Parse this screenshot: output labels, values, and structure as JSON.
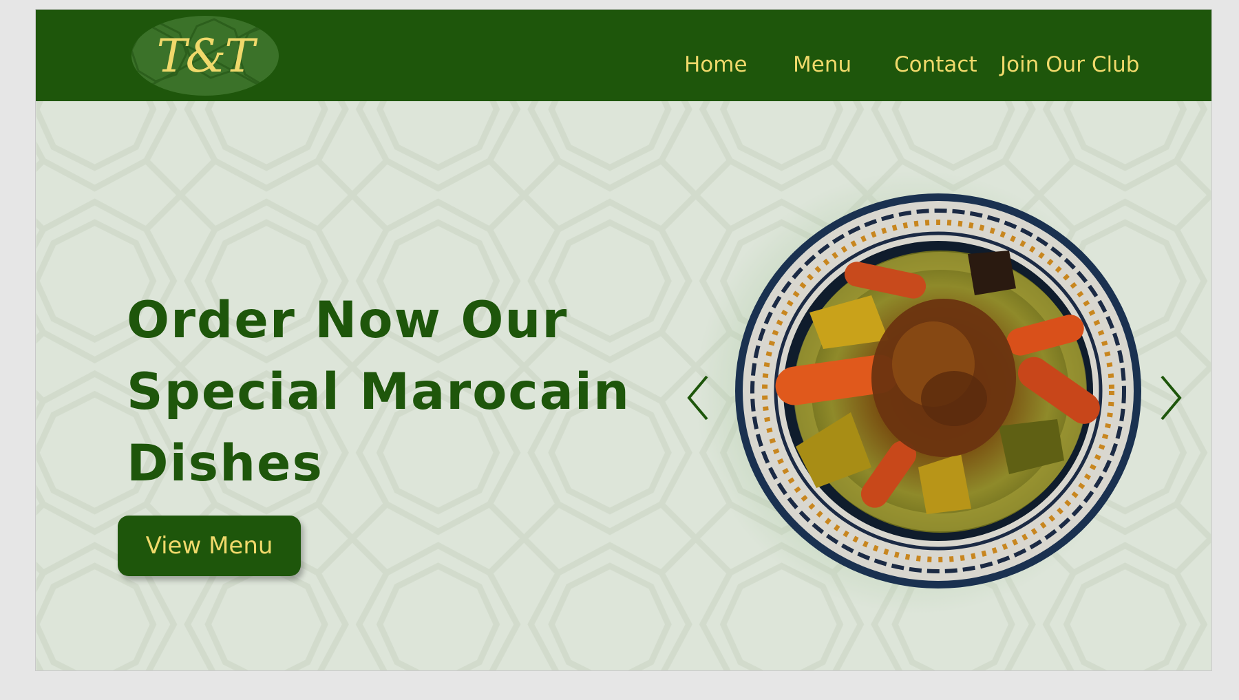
{
  "logo": {
    "text": "T&T"
  },
  "nav": {
    "items": [
      {
        "label": "Home"
      },
      {
        "label": "Menu"
      },
      {
        "label": "Contact"
      },
      {
        "label": "Join Our Club"
      }
    ]
  },
  "hero": {
    "title_lines": [
      "Order Now Our",
      "Special Marocain",
      "Dishes"
    ],
    "button_label": "View Menu"
  },
  "carousel": {
    "prev_icon": "chevron-left-icon",
    "next_icon": "chevron-right-icon"
  },
  "colors": {
    "brand_green": "#1e560b",
    "accent_yellow": "#f0d96b",
    "page_background": "#dde5d9"
  }
}
